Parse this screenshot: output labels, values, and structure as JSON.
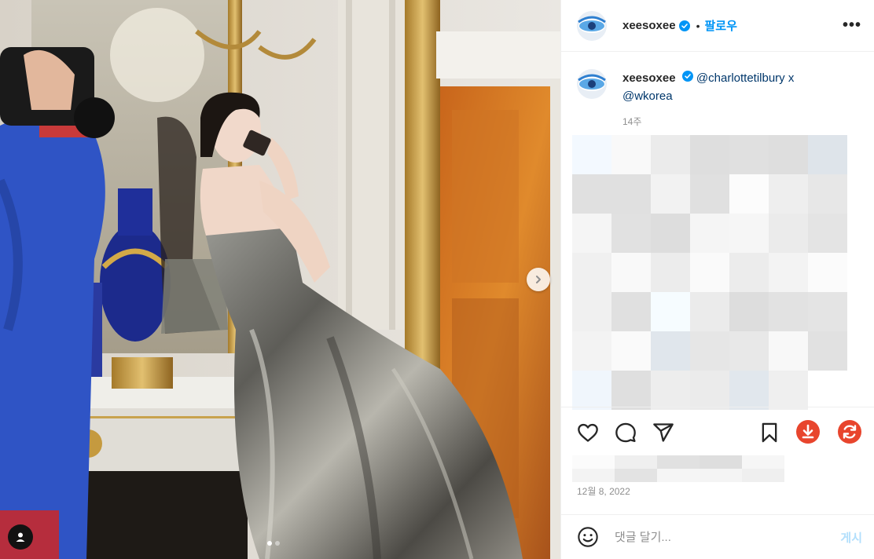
{
  "post": {
    "author": "xeesoxee",
    "verified": true,
    "follow_label": "팔로우",
    "separator": "•",
    "more_label": "•••"
  },
  "caption": {
    "username": "xeesoxee",
    "text": "@charlottetilbury x @wkorea",
    "time": "14주"
  },
  "actions": {
    "icons": [
      "heart-icon",
      "comment-icon",
      "share-icon",
      "bookmark-icon",
      "download-icon",
      "refresh-icon"
    ],
    "accent_red": "#e8452d"
  },
  "date": "12월 8, 2022",
  "comment": {
    "placeholder": "댓글 달기...",
    "post_label": "게시"
  },
  "media": {
    "carousel_index": 1,
    "carousel_count": 2,
    "next_icon": "chevron-right-icon",
    "tag_icon": "user-tag-icon"
  },
  "colors": {
    "follow": "#0095f6",
    "verified": "#0095f6",
    "mention": "#00376b",
    "post_disabled": "#b2dffc"
  }
}
